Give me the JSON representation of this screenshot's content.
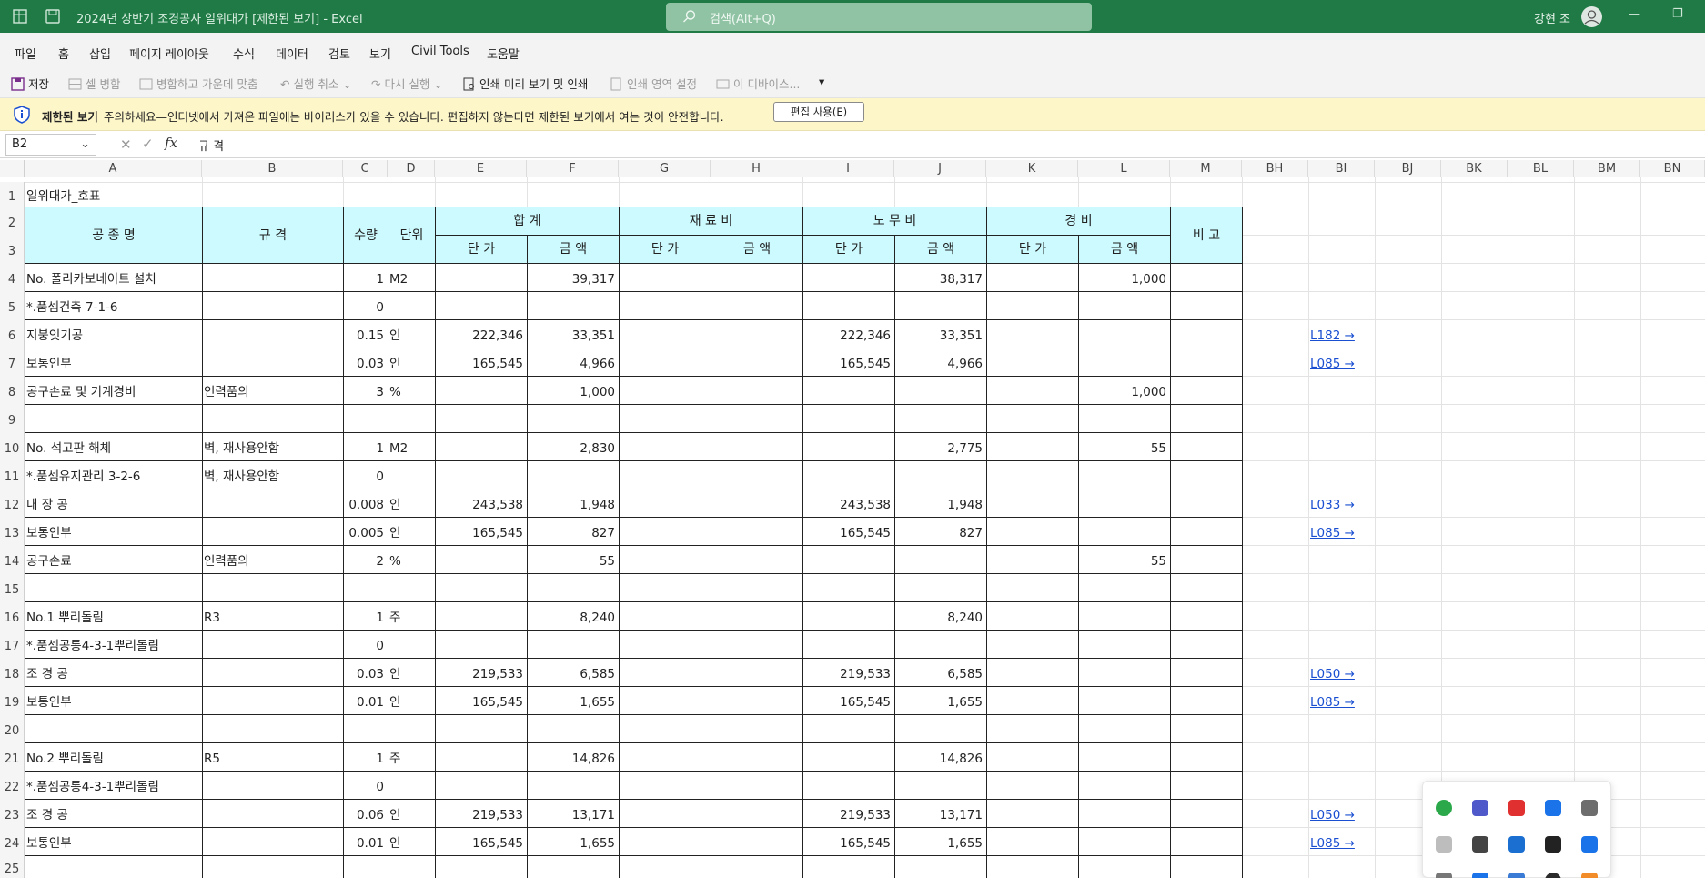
{
  "window": {
    "title": "2024년 상반기 조경공사 일위대가 [제한된 보기] - Excel",
    "search_placeholder": "검색(Alt+Q)",
    "user": "강현 조"
  },
  "menu": [
    "파일",
    "홈",
    "삽입",
    "페이지 레이아웃",
    "수식",
    "데이터",
    "검토",
    "보기",
    "Civil Tools",
    "도움말"
  ],
  "toolbar": {
    "save": "저장",
    "merge": "셀 병합",
    "merge_center": "병합하고 가운데 맞춤",
    "undo": "실행 취소",
    "redo": "다시 실행",
    "print_preview": "인쇄 미리 보기 및 인쇄",
    "print_area": "인쇄 영역 설정",
    "this_device": "이 디바이스..."
  },
  "message_bar": {
    "title": "제한된 보기",
    "text": "주의하세요—인터넷에서 가져온 파일에는 바이러스가 있을 수 있습니다. 편집하지 않는다면 제한된 보기에서 여는 것이 안전합니다.",
    "button": "편집 사용(E)"
  },
  "formula_bar": {
    "name_box": "B2",
    "content": "규 격"
  },
  "columns": [
    "A",
    "B",
    "C",
    "D",
    "E",
    "F",
    "G",
    "H",
    "I",
    "J",
    "K",
    "L",
    "M",
    "BH",
    "BI",
    "BJ",
    "BK",
    "BL",
    "BM",
    "BN"
  ],
  "sheet": {
    "title": "일위대가_호표",
    "header": {
      "name": "공 종 명",
      "spec": "규 격",
      "qty": "수량",
      "unit": "단위",
      "total": "합    계",
      "material": "재 료 비",
      "labor": "노 무 비",
      "expense": "경    비",
      "note": "비 고",
      "unit_price": "단 가",
      "amount": "금 액"
    },
    "row_numbers": [
      "1",
      "2",
      "3",
      "4",
      "5",
      "6",
      "7",
      "8",
      "9",
      "10",
      "11",
      "12",
      "13",
      "14",
      "15",
      "16",
      "17",
      "18",
      "19",
      "20",
      "21",
      "22",
      "23",
      "24",
      "25"
    ],
    "rows": [
      {
        "name": "No.  폴리카보네이트 설치",
        "spec": "",
        "qty": "1",
        "unit": "M2",
        "tot_up": "",
        "tot_amt": "39,317",
        "mat_up": "",
        "mat_amt": "",
        "lab_up": "",
        "lab_amt": "38,317",
        "exp_up": "",
        "exp_amt": "1,000",
        "link": ""
      },
      {
        "name": "   *.품셈건축 7-1-6",
        "spec": "",
        "qty": "0",
        "unit": "",
        "tot_up": "",
        "tot_amt": "",
        "mat_up": "",
        "mat_amt": "",
        "lab_up": "",
        "lab_amt": "",
        "exp_up": "",
        "exp_amt": "",
        "link": ""
      },
      {
        "name": "   지붕잇기공",
        "spec": "",
        "qty": "0.15",
        "unit": "인",
        "tot_up": "222,346",
        "tot_amt": "33,351",
        "mat_up": "",
        "mat_amt": "",
        "lab_up": "222,346",
        "lab_amt": "33,351",
        "exp_up": "",
        "exp_amt": "",
        "link": "L182 →"
      },
      {
        "name": "   보통인부",
        "spec": "",
        "qty": "0.03",
        "unit": "인",
        "tot_up": "165,545",
        "tot_amt": "4,966",
        "mat_up": "",
        "mat_amt": "",
        "lab_up": "165,545",
        "lab_amt": "4,966",
        "exp_up": "",
        "exp_amt": "",
        "link": "L085 →"
      },
      {
        "name": "   공구손료 및 기계경비",
        "spec": "인력품의",
        "qty": "3",
        "unit": "%",
        "tot_up": "",
        "tot_amt": "1,000",
        "mat_up": "",
        "mat_amt": "",
        "lab_up": "",
        "lab_amt": "",
        "exp_up": "",
        "exp_amt": "1,000",
        "link": ""
      },
      {
        "name": "",
        "spec": "",
        "qty": "",
        "unit": "",
        "tot_up": "",
        "tot_amt": "",
        "mat_up": "",
        "mat_amt": "",
        "lab_up": "",
        "lab_amt": "",
        "exp_up": "",
        "exp_amt": "",
        "link": ""
      },
      {
        "name": "No.  석고판 해체",
        "spec": "벽, 재사용안함",
        "qty": "1",
        "unit": "M2",
        "tot_up": "",
        "tot_amt": "2,830",
        "mat_up": "",
        "mat_amt": "",
        "lab_up": "",
        "lab_amt": "2,775",
        "exp_up": "",
        "exp_amt": "55",
        "link": ""
      },
      {
        "name": "   *.품셈유지관리 3-2-6",
        "spec": "벽, 재사용안함",
        "qty": "0",
        "unit": "",
        "tot_up": "",
        "tot_amt": "",
        "mat_up": "",
        "mat_amt": "",
        "lab_up": "",
        "lab_amt": "",
        "exp_up": "",
        "exp_amt": "",
        "link": ""
      },
      {
        "name": "   내 장 공",
        "spec": "",
        "qty": "0.008",
        "unit": "인",
        "tot_up": "243,538",
        "tot_amt": "1,948",
        "mat_up": "",
        "mat_amt": "",
        "lab_up": "243,538",
        "lab_amt": "1,948",
        "exp_up": "",
        "exp_amt": "",
        "link": "L033 →"
      },
      {
        "name": "   보통인부",
        "spec": "",
        "qty": "0.005",
        "unit": "인",
        "tot_up": "165,545",
        "tot_amt": "827",
        "mat_up": "",
        "mat_amt": "",
        "lab_up": "165,545",
        "lab_amt": "827",
        "exp_up": "",
        "exp_amt": "",
        "link": "L085 →"
      },
      {
        "name": "   공구손료",
        "spec": "인력품의",
        "qty": "2",
        "unit": "%",
        "tot_up": "",
        "tot_amt": "55",
        "mat_up": "",
        "mat_amt": "",
        "lab_up": "",
        "lab_amt": "",
        "exp_up": "",
        "exp_amt": "55",
        "link": ""
      },
      {
        "name": "",
        "spec": "",
        "qty": "",
        "unit": "",
        "tot_up": "",
        "tot_amt": "",
        "mat_up": "",
        "mat_amt": "",
        "lab_up": "",
        "lab_amt": "",
        "exp_up": "",
        "exp_amt": "",
        "link": ""
      },
      {
        "name": "No.1  뿌리돌림",
        "spec": "R3",
        "qty": "1",
        "unit": "주",
        "tot_up": "",
        "tot_amt": "8,240",
        "mat_up": "",
        "mat_amt": "",
        "lab_up": "",
        "lab_amt": "8,240",
        "exp_up": "",
        "exp_amt": "",
        "link": ""
      },
      {
        "name": "   *.품셈공통4-3-1뿌리돌림",
        "spec": "",
        "qty": "0",
        "unit": "",
        "tot_up": "",
        "tot_amt": "",
        "mat_up": "",
        "mat_amt": "",
        "lab_up": "",
        "lab_amt": "",
        "exp_up": "",
        "exp_amt": "",
        "link": ""
      },
      {
        "name": "   조 경 공",
        "spec": "",
        "qty": "0.03",
        "unit": "인",
        "tot_up": "219,533",
        "tot_amt": "6,585",
        "mat_up": "",
        "mat_amt": "",
        "lab_up": "219,533",
        "lab_amt": "6,585",
        "exp_up": "",
        "exp_amt": "",
        "link": "L050 →"
      },
      {
        "name": "   보통인부",
        "spec": "",
        "qty": "0.01",
        "unit": "인",
        "tot_up": "165,545",
        "tot_amt": "1,655",
        "mat_up": "",
        "mat_amt": "",
        "lab_up": "165,545",
        "lab_amt": "1,655",
        "exp_up": "",
        "exp_amt": "",
        "link": "L085 →"
      },
      {
        "name": "",
        "spec": "",
        "qty": "",
        "unit": "",
        "tot_up": "",
        "tot_amt": "",
        "mat_up": "",
        "mat_amt": "",
        "lab_up": "",
        "lab_amt": "",
        "exp_up": "",
        "exp_amt": "",
        "link": ""
      },
      {
        "name": "No.2  뿌리돌림",
        "spec": "R5",
        "qty": "1",
        "unit": "주",
        "tot_up": "",
        "tot_amt": "14,826",
        "mat_up": "",
        "mat_amt": "",
        "lab_up": "",
        "lab_amt": "14,826",
        "exp_up": "",
        "exp_amt": "",
        "link": ""
      },
      {
        "name": "   *.품셈공통4-3-1뿌리돌림",
        "spec": "",
        "qty": "0",
        "unit": "",
        "tot_up": "",
        "tot_amt": "",
        "mat_up": "",
        "mat_amt": "",
        "lab_up": "",
        "lab_amt": "",
        "exp_up": "",
        "exp_amt": "",
        "link": ""
      },
      {
        "name": "   조 경 공",
        "spec": "",
        "qty": "0.06",
        "unit": "인",
        "tot_up": "219,533",
        "tot_amt": "13,171",
        "mat_up": "",
        "mat_amt": "",
        "lab_up": "219,533",
        "lab_amt": "13,171",
        "exp_up": "",
        "exp_amt": "",
        "link": "L050 →"
      },
      {
        "name": "   보통인부",
        "spec": "",
        "qty": "0.01",
        "unit": "인",
        "tot_up": "165,545",
        "tot_amt": "1,655",
        "mat_up": "",
        "mat_amt": "",
        "lab_up": "165,545",
        "lab_amt": "1,655",
        "exp_up": "",
        "exp_amt": "",
        "link": "L085 →"
      }
    ]
  },
  "tray_icons": [
    "security-check-icon",
    "teams-icon",
    "record-icon",
    "sync-icon",
    "network-card-icon",
    "usb-device-icon",
    "image-tool-icon",
    "display-icon",
    "nvidia-icon",
    "defender-warning-icon",
    "app-generic-icon",
    "bluetooth-icon",
    "shield-icon",
    "kakaotalk-icon",
    "notification-app-icon"
  ],
  "colors": {
    "title_bar": "#1f7a45",
    "header_fill": "#ccfaff",
    "message_bar": "#fdf6c9",
    "link": "#1a4fd1"
  }
}
